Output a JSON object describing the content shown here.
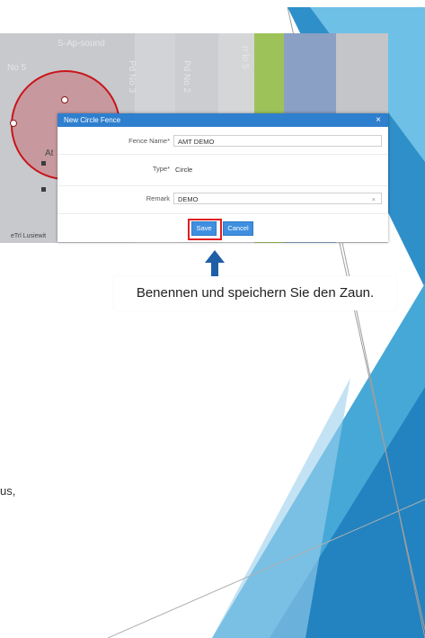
{
  "map": {
    "labels": [
      "S-Ap-sound",
      "No 5"
    ],
    "vertical_labels": [
      "Pd No 3",
      "Pd No 2",
      "rr lo 5"
    ],
    "left_text": "At",
    "bottom_left_text": "eTrl Lusiewit"
  },
  "dialog": {
    "title": "New Circle Fence",
    "close_label": "×",
    "fence_name_label": "Fence Name*",
    "fence_name_value": "AMT DEMO",
    "type_label": "Type*",
    "type_value": "Circle",
    "remark_label": "Remark",
    "remark_value": "DEMO",
    "clear_label": "×",
    "save_label": "Save",
    "cancel_label": "Cancel"
  },
  "caption": "Benennen und speichern Sie den Zaun.",
  "partial_text": "us,",
  "colors": {
    "title_bar": "#2f7fcf",
    "button": "#3f8fe0",
    "highlight": "#e02020",
    "arrow": "#1f5fa8"
  }
}
